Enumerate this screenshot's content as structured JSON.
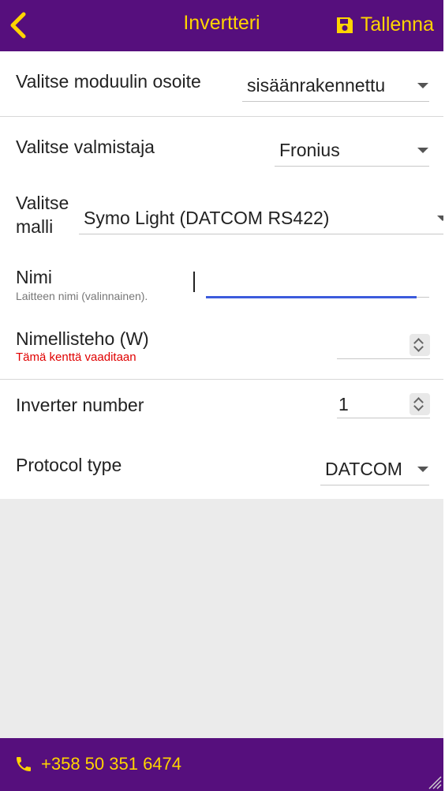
{
  "header": {
    "title": "Invertteri",
    "save_label": "Tallenna",
    "back_icon": "chevron-left-icon",
    "save_icon": "floppy-disk-icon"
  },
  "form": {
    "module_address": {
      "label": "Valitse moduulin osoite",
      "value": "sisäänrakennettu"
    },
    "manufacturer": {
      "label": "Valitse valmistaja",
      "value": "Fronius"
    },
    "model": {
      "label_line1": "Valitse",
      "label_line2": "malli",
      "value": "Symo Light (DATCOM RS422)"
    },
    "name": {
      "label": "Nimi",
      "hint": "Laitteen nimi (valinnainen).",
      "value": ""
    },
    "nominal_power": {
      "label": "Nimellisteho (W)",
      "error": "Tämä kenttä vaaditaan",
      "value": ""
    },
    "inverter_number": {
      "label": "Inverter number",
      "value": "1"
    },
    "protocol_type": {
      "label": "Protocol type",
      "value": "DATCOM"
    }
  },
  "footer": {
    "phone": "+358 50 351 6474",
    "phone_icon": "phone-icon"
  },
  "colors": {
    "brand": "#560f7d",
    "accent": "#ffd400",
    "error": "#e00000",
    "focus": "#3c5bdc"
  }
}
